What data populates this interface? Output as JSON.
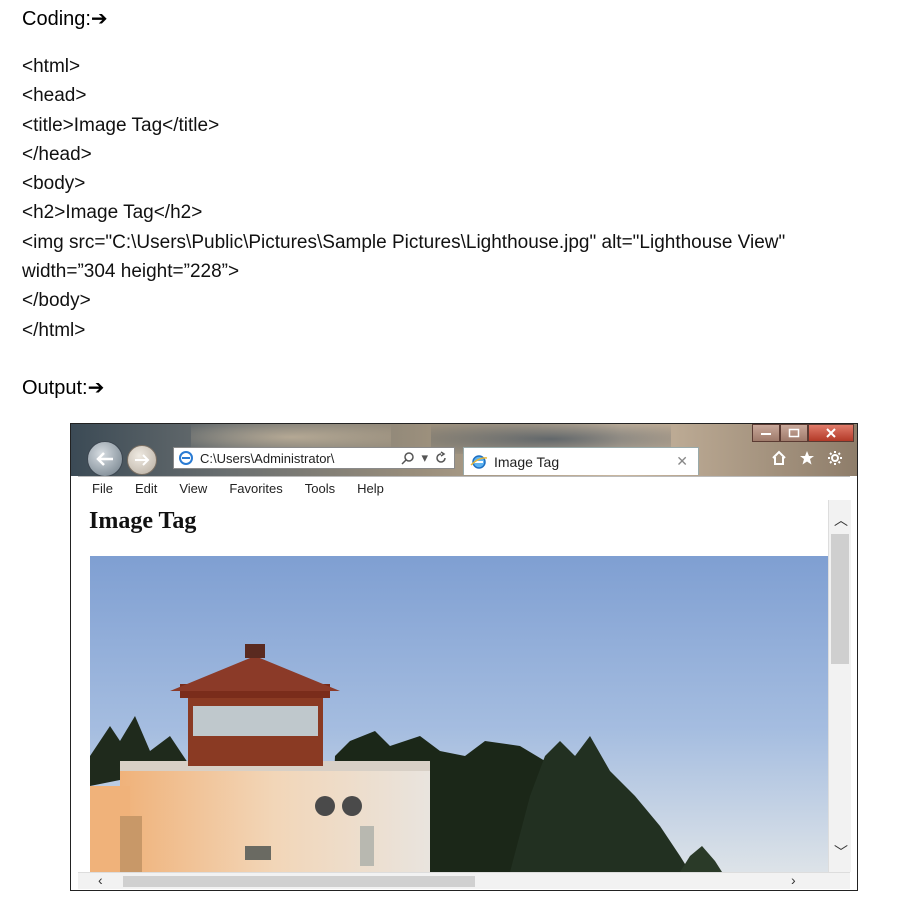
{
  "coding_heading": "Coding:➔",
  "code_lines": [
    "<html>",
    "<head>",
    "<title>Image Tag</title>",
    "</head>",
    "<body>",
    "<h2>Image Tag</h2>",
    "<img src=\"C:\\Users\\Public\\Pictures\\Sample Pictures\\Lighthouse.jpg\" alt=\"Lighthouse View\" width=”304 height=”228”>",
    "</body>",
    "</html>"
  ],
  "output_heading": "Output:➔",
  "browser": {
    "address": "C:\\Users\\Administrator\\",
    "tab_title": "Image Tag",
    "menu": [
      "File",
      "Edit",
      "View",
      "Favorites",
      "Tools",
      "Help"
    ],
    "page_heading": "Image Tag",
    "icons": [
      "back-arrow-icon",
      "forward-arrow-icon",
      "ie-icon",
      "search-icon",
      "refresh-icon",
      "home-icon",
      "star-icon",
      "gear-icon"
    ]
  }
}
